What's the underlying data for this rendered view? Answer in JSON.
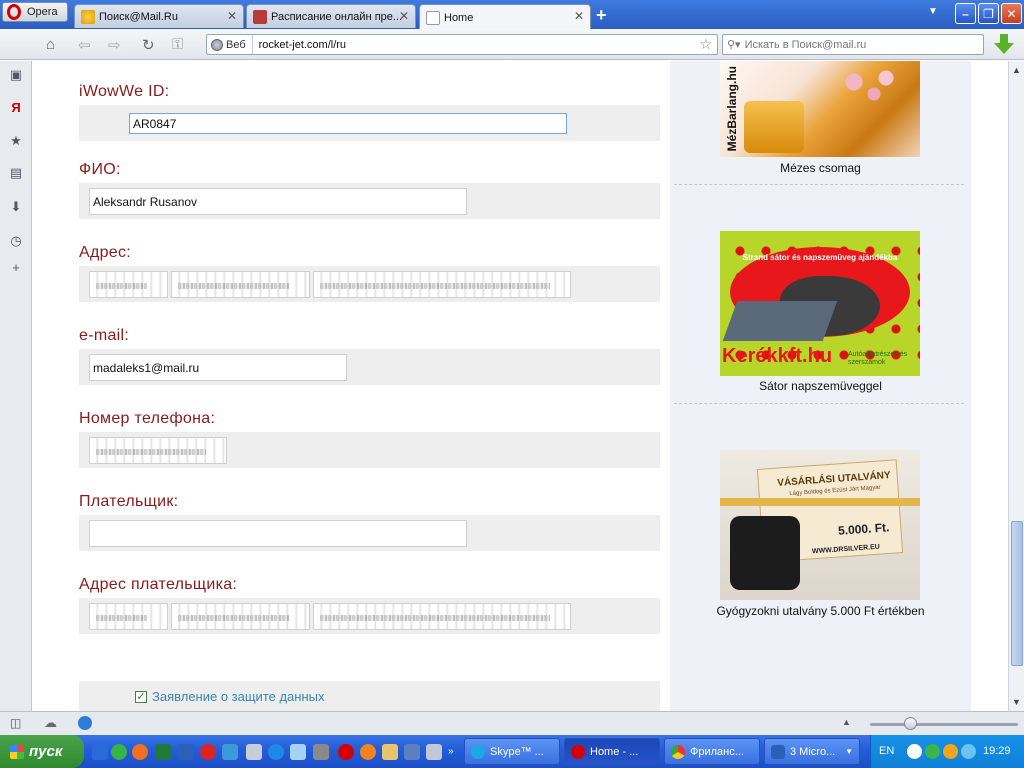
{
  "browser": {
    "opera_label": "Opera",
    "tabs": [
      {
        "title": "Поиск@Mail.Ru",
        "icon": "mailru-search-icon"
      },
      {
        "title": "Расписание онлайн пре...",
        "icon": "schedule-icon"
      },
      {
        "title": "Home",
        "icon": "page-icon"
      }
    ],
    "new_tab_symbol": "+",
    "address": {
      "badge": "Веб",
      "url": "rocket-jet.com/l/ru"
    },
    "search_placeholder": "Искать в Поиск@mail.ru"
  },
  "form": {
    "fields": [
      {
        "label": "iWowWe ID:",
        "value": "AR0847"
      },
      {
        "label": "ФИО:",
        "value": "Aleksandr Rusanov"
      },
      {
        "label": "Адрес:",
        "value": ""
      },
      {
        "label": "e-mail:",
        "value": "madaleks1@mail.ru"
      },
      {
        "label": "Номер телефона:",
        "value": ""
      },
      {
        "label": "Плательщик:",
        "value": ""
      },
      {
        "label": "Адрес плательщика:",
        "value": ""
      }
    ],
    "consent": {
      "checked": true,
      "label": "Заявление о защите данных"
    }
  },
  "sidebar": {
    "promos": [
      {
        "caption": "Mézes csomag",
        "image_text": "MézBarlang.hu"
      },
      {
        "caption": "Sátor napszemüveggel",
        "image_text_top": "Strand sátor és napszemüveg ajándékba",
        "image_brand": "Kerékkft.hu",
        "image_brand_small": "Autóalkatrészek és szerszámok"
      },
      {
        "caption": "Gyógyzokni utalvány 5.000 Ft értékben",
        "image_title": "VÁSÁRLÁSI UTALVÁNY",
        "image_sub": "Lágy Boldog és Ezüst Járt Magyar",
        "image_amount": "5.000. Ft.",
        "image_site": "WWW.DRSILVER.EU"
      }
    ]
  },
  "taskbar": {
    "start_label": "пуск",
    "tasks": [
      {
        "label": "Skype™ ...",
        "icon": "skype-icon"
      },
      {
        "label": "Home - ...",
        "icon": "opera-icon",
        "active": true
      },
      {
        "label": "Фриланс...",
        "icon": "chrome-icon"
      },
      {
        "label": "3 Micro...",
        "icon": "word-icon"
      }
    ],
    "lang": "EN",
    "clock": "19:29"
  },
  "colors": {
    "label": "#8b1a1a",
    "link": "#3a84b0",
    "field_bg": "#eeeeee"
  }
}
